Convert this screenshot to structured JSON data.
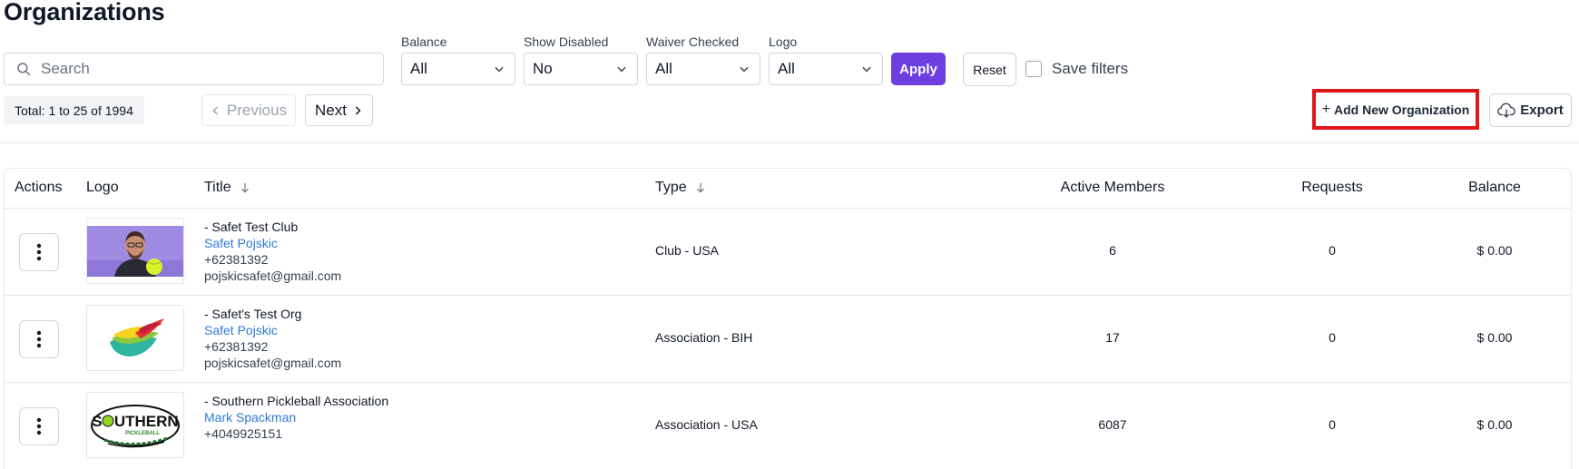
{
  "page_title": "Organizations",
  "search": {
    "placeholder": "Search",
    "value": ""
  },
  "filters": [
    {
      "label": "Balance",
      "value": "All"
    },
    {
      "label": "Show Disabled",
      "value": "No"
    },
    {
      "label": "Waiver Checked",
      "value": "All"
    },
    {
      "label": "Logo",
      "value": "All"
    }
  ],
  "buttons": {
    "apply": "Apply",
    "reset": "Reset",
    "save_filters": "Save filters",
    "add_new": "Add New Organization",
    "add_new_prefix": "+",
    "export": "Export"
  },
  "pagination": {
    "total_text": "Total: 1 to 25 of 1994",
    "previous": "Previous",
    "next": "Next"
  },
  "table": {
    "headers": {
      "actions": "Actions",
      "logo": "Logo",
      "title": "Title",
      "type": "Type",
      "active_members": "Active Members",
      "requests": "Requests",
      "balance": "Balance"
    },
    "rows": [
      {
        "title": "- Safet Test Club",
        "contact": "Safet Pojskic",
        "phone": "+62381392",
        "email": "pojskicsafet@gmail.com",
        "type": "Club - USA",
        "active_members": "6",
        "requests": "0",
        "balance": "$ 0.00",
        "logo": "person-photo"
      },
      {
        "title": "- Safet's Test Org",
        "contact": "Safet Pojskic",
        "phone": "+62381392",
        "email": "pojskicsafet@gmail.com",
        "type": "Association - BIH",
        "active_members": "17",
        "requests": "0",
        "balance": "$ 0.00",
        "logo": "color-swoosh"
      },
      {
        "title": "- Southern Pickleball Association",
        "contact": "Mark Spackman",
        "phone": "+4049925151",
        "email": "",
        "type": "Association - USA",
        "active_members": "6087",
        "requests": "0",
        "balance": "$ 0.00",
        "logo": "southern-pickleball-logo",
        "logo_text": "SOUTHERN",
        "logo_subtext": "PICKLEBALL"
      }
    ]
  },
  "colors": {
    "primary": "#6d3fe0",
    "link": "#2f7bd6",
    "highlight": "#e0161b"
  }
}
